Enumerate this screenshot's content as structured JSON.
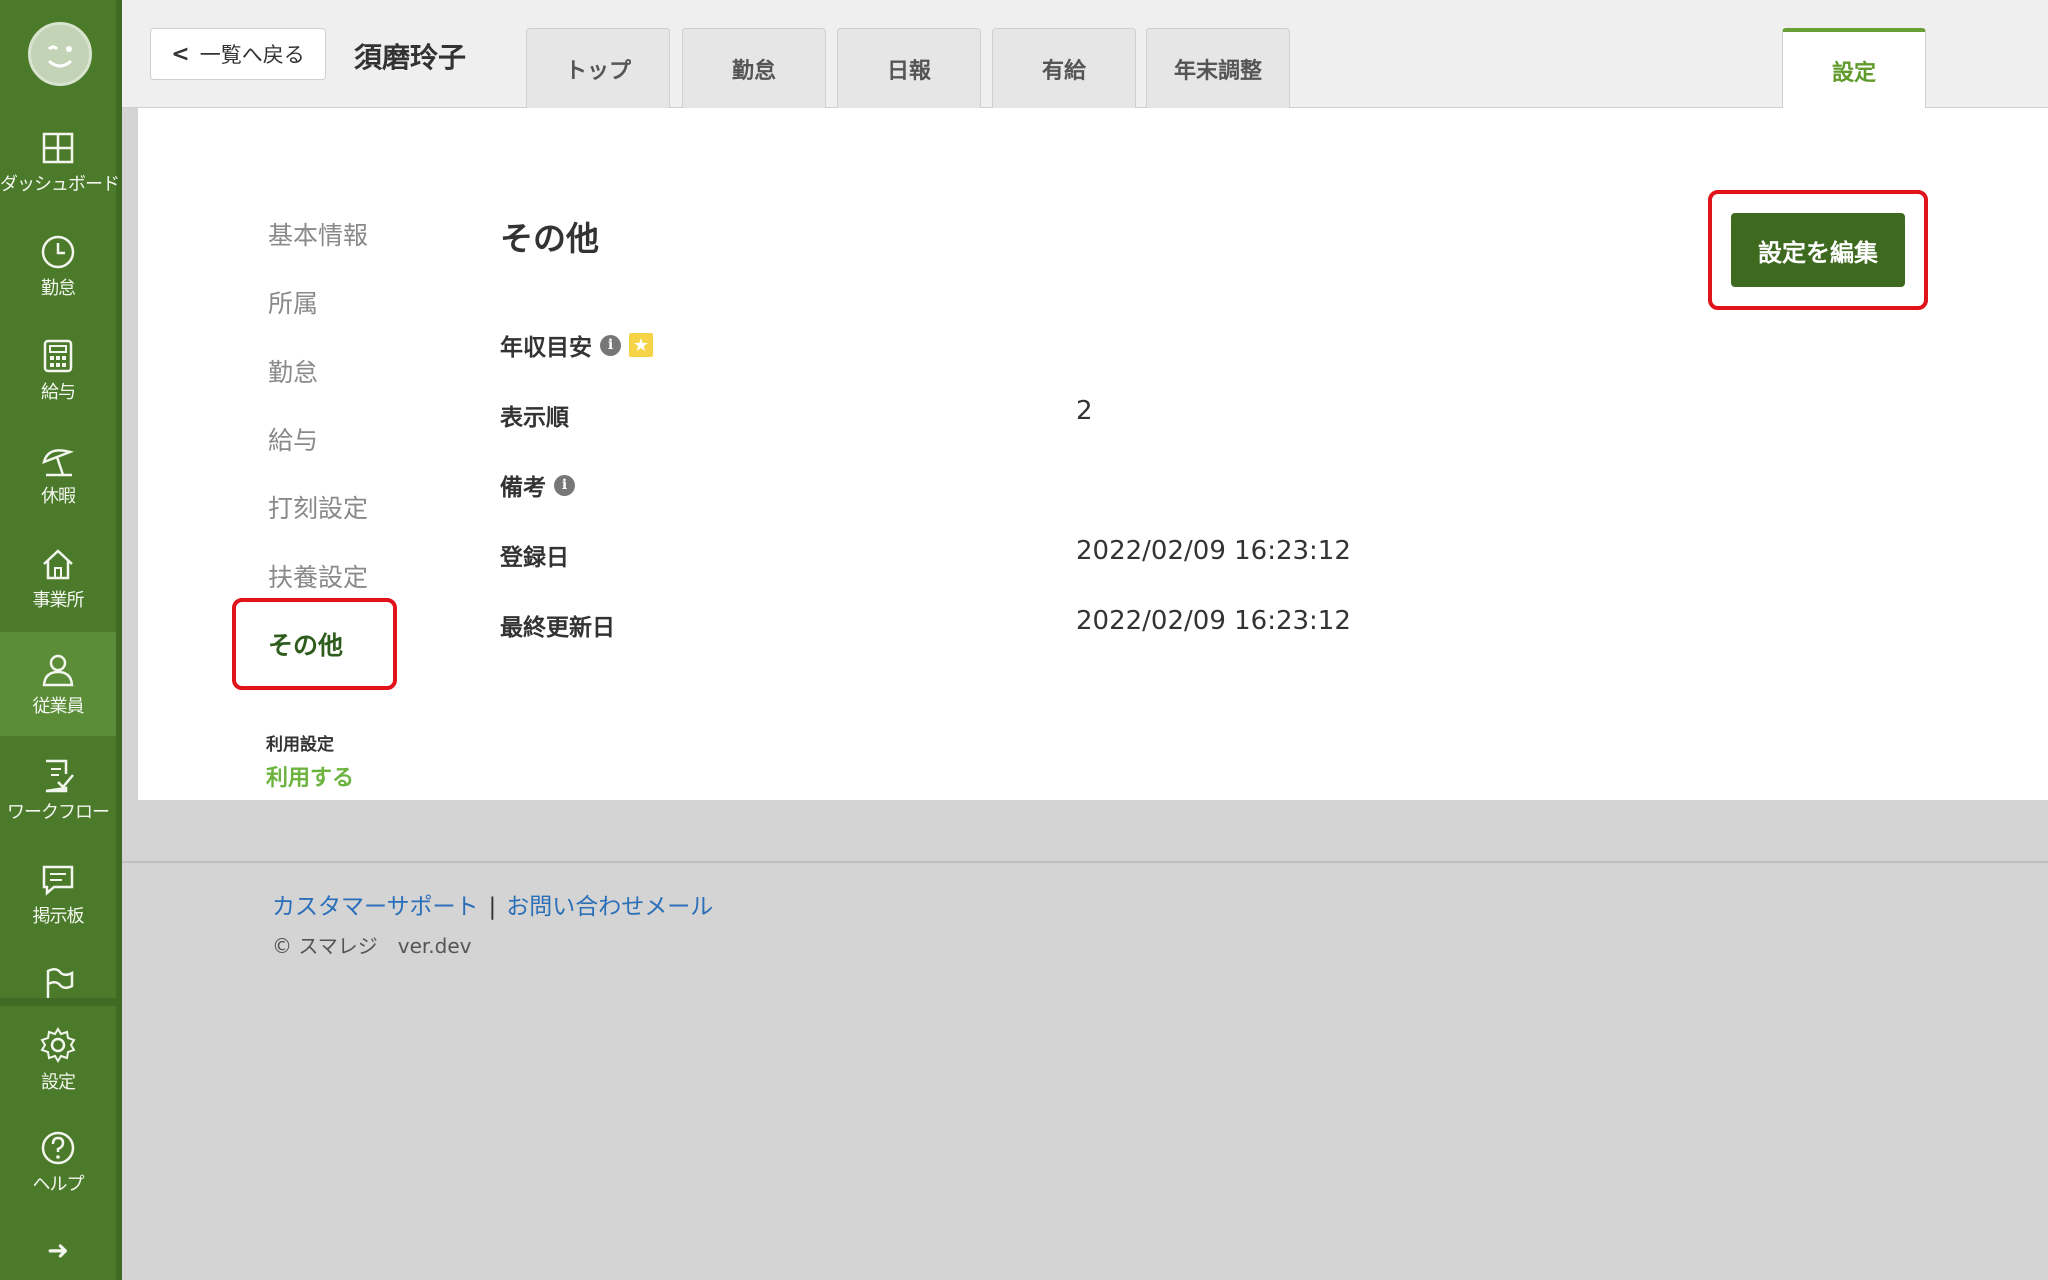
{
  "header": {
    "back_label": "一覧へ戻る",
    "employee_name": "須磨玲子",
    "tabs": [
      {
        "label": "トップ"
      },
      {
        "label": "勤怠"
      },
      {
        "label": "日報"
      },
      {
        "label": "有給"
      },
      {
        "label": "年末調整"
      },
      {
        "label": "設定"
      }
    ],
    "active_tab": "設定"
  },
  "sidebar": {
    "items": [
      {
        "label": "ダッシュボード",
        "icon": "dashboard-icon"
      },
      {
        "label": "勤怠",
        "icon": "clock-icon"
      },
      {
        "label": "給与",
        "icon": "calculator-icon"
      },
      {
        "label": "休暇",
        "icon": "umbrella-icon"
      },
      {
        "label": "事業所",
        "icon": "home-icon"
      },
      {
        "label": "従業員",
        "icon": "person-icon"
      },
      {
        "label": "ワークフロー",
        "icon": "checklist-icon"
      },
      {
        "label": "掲示板",
        "icon": "chat-icon"
      },
      {
        "label": "",
        "icon": "flag-icon"
      },
      {
        "label": "設定",
        "icon": "gear-icon"
      },
      {
        "label": "ヘルプ",
        "icon": "help-icon"
      }
    ],
    "active": "従業員",
    "expand_icon": "arrow-right-icon"
  },
  "subnav": {
    "items": [
      {
        "label": "基本情報"
      },
      {
        "label": "所属"
      },
      {
        "label": "勤怠"
      },
      {
        "label": "給与"
      },
      {
        "label": "打刻設定"
      },
      {
        "label": "扶養設定"
      },
      {
        "label": "その他"
      }
    ],
    "active": "その他",
    "usage_label": "利用設定",
    "usage_value": "利用する"
  },
  "main": {
    "section_title": "その他",
    "edit_button": "設定を編集",
    "rows": [
      {
        "label": "年収目安",
        "value": ""
      },
      {
        "label": "表示順",
        "value": "2"
      },
      {
        "label": "備考",
        "value": ""
      },
      {
        "label": "登録日",
        "value": "2022/02/09 16:23:12"
      },
      {
        "label": "最終更新日",
        "value": "2022/02/09 16:23:12"
      }
    ]
  },
  "footer": {
    "support_link": "カスタマーサポート",
    "separator": "|",
    "contact_link": "お問い合わせメール",
    "copyright": "© スマレジ　ver.dev"
  },
  "colors": {
    "sidebar": "#4a7a2a",
    "accent_green": "#6db33f",
    "button_green": "#3e6a1f",
    "highlight_red": "#e0121a",
    "link_blue": "#2a6fb8"
  }
}
